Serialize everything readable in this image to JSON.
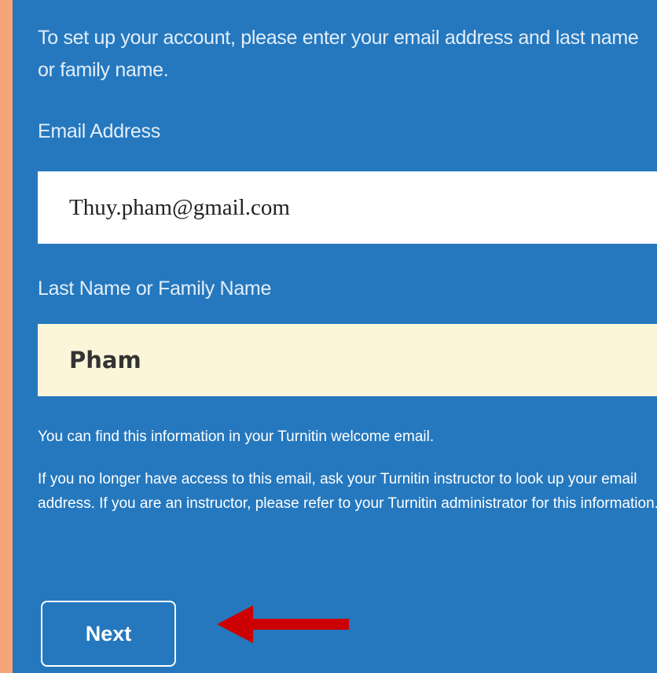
{
  "form": {
    "intro_text": "To set up your account, please enter your email address and last name or family name.",
    "email_label": "Email Address",
    "email_value": "Thuy.pham@gmail.com",
    "last_name_label": "Last Name or Family Name",
    "last_name_value": "Pham",
    "help_text_1": "You can find this information in your Turnitin welcome email.",
    "help_text_2": "If you no longer have access to this email, ask your Turnitin instructor to look up your email address. If you are an instructor, please refer to your Turnitin administrator for this information.",
    "next_label": "Next"
  },
  "annotation": {
    "arrow_icon": "left-arrow-icon",
    "arrow_color": "#cc0000"
  },
  "colors": {
    "outer_background": "#f5a578",
    "panel_background": "#2578be",
    "email_field_background": "#ffffff",
    "last_name_field_background": "#fbf5d9"
  }
}
